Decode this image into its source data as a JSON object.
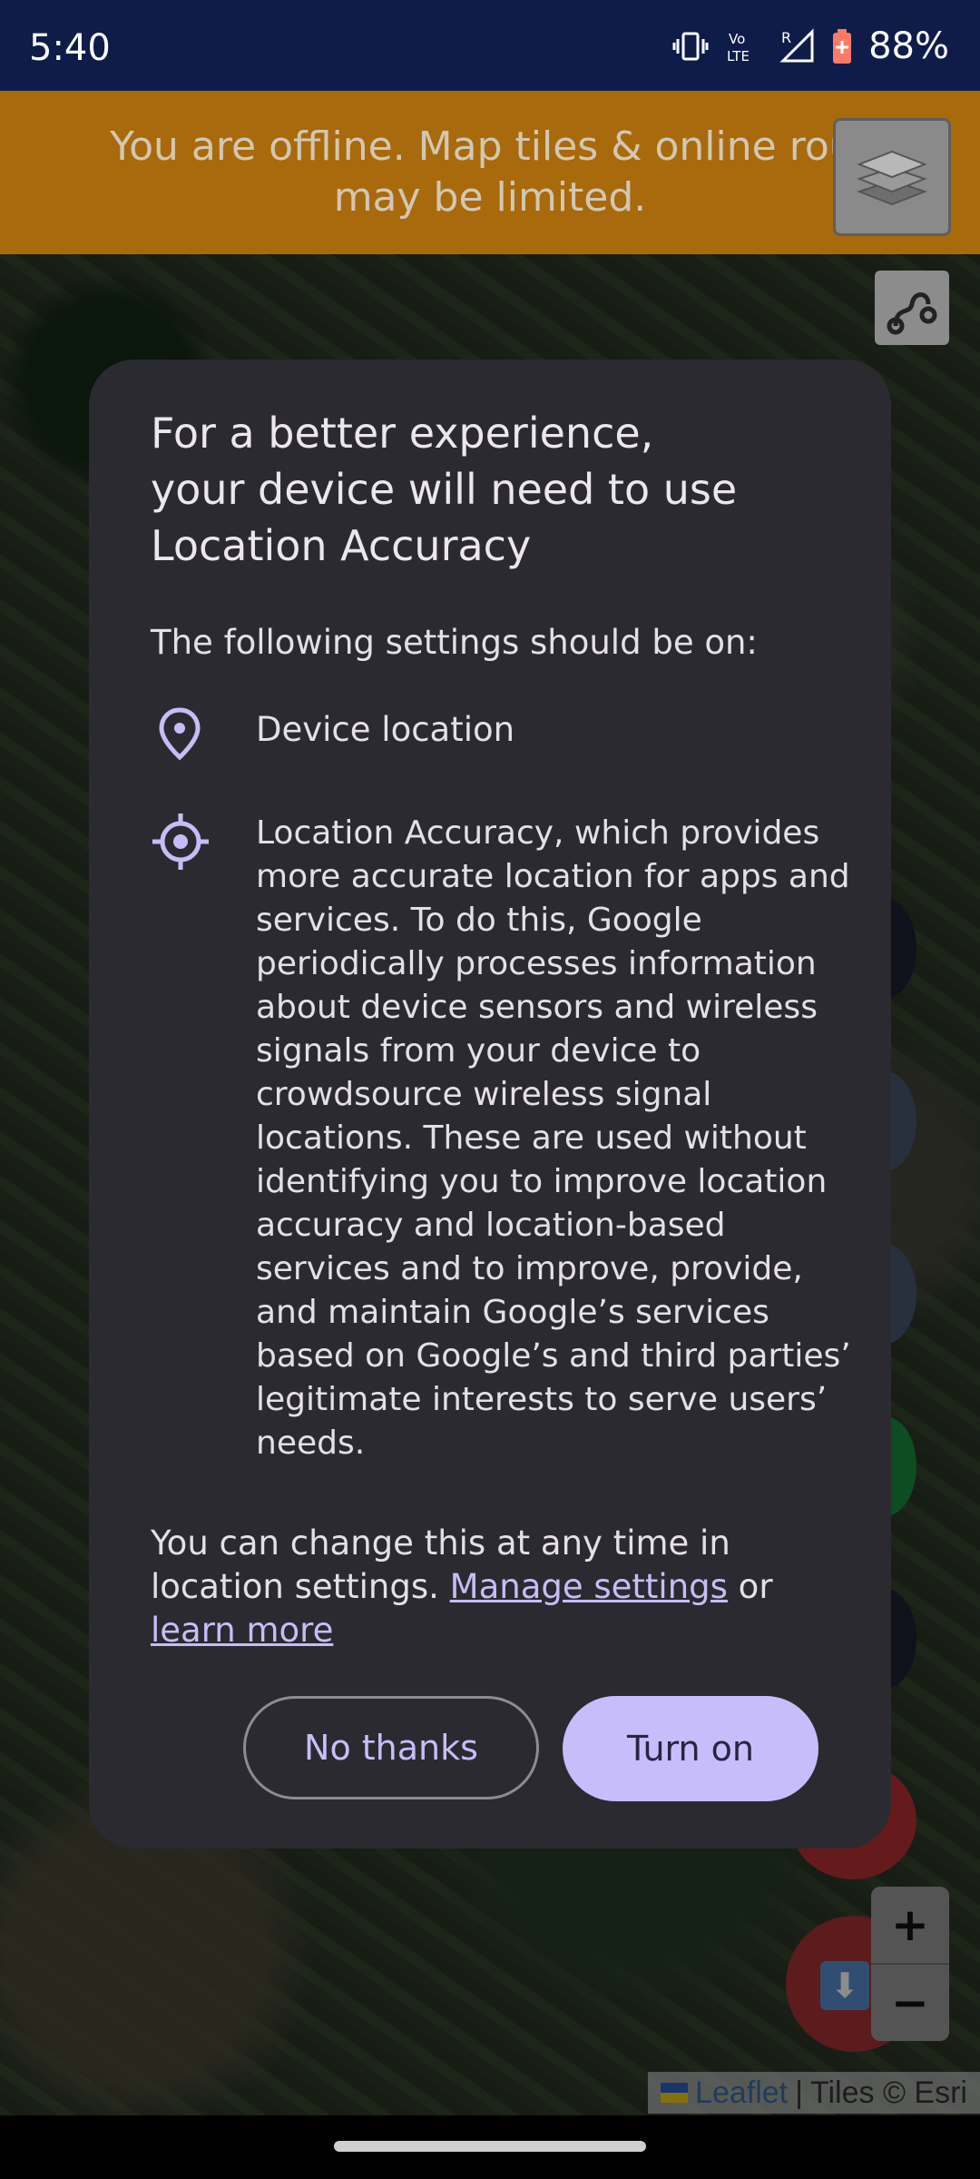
{
  "status_bar": {
    "time": "5:40",
    "battery_percent": "88%",
    "volte_label": "Vo\nLTE",
    "signal_label": "R",
    "icons": [
      "vibrate-icon",
      "volte-icon",
      "signal-icon",
      "battery-icon"
    ]
  },
  "banner": {
    "text": "You are offline. Map tiles & online rout\nmay be limited.",
    "color": "#a86a0c"
  },
  "map_controls": {
    "layers_icon": "layers-icon",
    "route_icon": "route-icon",
    "zoom_in": "+",
    "zoom_out": "−",
    "download_icon": "download-icon"
  },
  "dialog": {
    "title": "For a better experience,\nyour device will need to use\nLocation Accuracy",
    "subtitle": "The following settings should be on:",
    "device_location_label": "Device location",
    "accuracy_text": "Location Accuracy, which provides more accurate location for apps and services. To do this, Google periodically processes information about device sensors and wireless signals from your device to crowdsource wireless signal locations. These are used without identifying you to improve location accuracy and location-based services and to improve, provide, and maintain Google’s services based on Google’s and third parties’ legitimate interests to serve users’ needs.",
    "change_text_prefix": "You can change this at any time in location settings. ",
    "manage_link": "Manage settings",
    "change_text_or": " or ",
    "learn_more_link": "learn more",
    "no_thanks_label": "No thanks",
    "turn_on_label": "Turn on",
    "accent": "#c8bdfb"
  },
  "attribution": {
    "leaflet": "Leaflet",
    "separator": " | ",
    "tiles": "Tiles © Esri"
  }
}
